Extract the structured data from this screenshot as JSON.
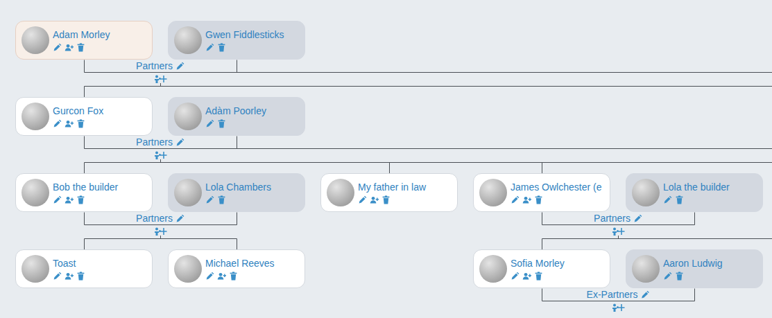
{
  "tree": {
    "members": [
      {
        "name": "Adam Morley",
        "partner": false,
        "selected": true
      },
      {
        "name": "Gwen Fiddlesticks",
        "partner": true,
        "selected": false
      }
    ],
    "relation": "Partners",
    "partner_line_continues": true,
    "children_line_continues": true,
    "children": [
      {
        "members": [
          {
            "name": "Gurcon Fox",
            "partner": false,
            "selected": false
          },
          {
            "name": "Adàm Poorley",
            "partner": true,
            "selected": false
          }
        ],
        "relation": "Partners",
        "partner_line_continues": true,
        "children_line_continues": true,
        "children": [
          {
            "members": [
              {
                "name": "Bob the builder",
                "partner": false,
                "selected": false
              },
              {
                "name": "Lola Chambers",
                "partner": true,
                "selected": false
              }
            ],
            "relation": "Partners",
            "partner_line_continues": false,
            "children_line_continues": false,
            "children": [
              {
                "members": [
                  {
                    "name": "Toast",
                    "partner": false,
                    "selected": false
                  }
                ],
                "relation": "",
                "partner_line_continues": false,
                "children_line_continues": false,
                "children": []
              },
              {
                "members": [
                  {
                    "name": "Michael Reeves",
                    "partner": false,
                    "selected": false
                  }
                ],
                "relation": "",
                "partner_line_continues": false,
                "children_line_continues": false,
                "children": []
              }
            ]
          },
          {
            "members": [
              {
                "name": "My father in law",
                "partner": false,
                "selected": false
              }
            ],
            "relation": "",
            "partner_line_continues": false,
            "children_line_continues": false,
            "children": []
          },
          {
            "members": [
              {
                "name": "James Owlchester (e",
                "partner": false,
                "selected": false
              },
              {
                "name": "Lola the builder",
                "partner": true,
                "selected": false
              }
            ],
            "relation": "Partners",
            "partner_line_continues": false,
            "children_line_continues": true,
            "children": [
              {
                "members": [
                  {
                    "name": "Sofia Morley",
                    "partner": false,
                    "selected": false
                  },
                  {
                    "name": "Aaron Ludwig",
                    "partner": true,
                    "selected": false
                  }
                ],
                "relation": "Ex-Partners",
                "partner_line_continues": false,
                "children_line_continues": false,
                "children": []
              }
            ]
          }
        ]
      }
    ]
  }
}
